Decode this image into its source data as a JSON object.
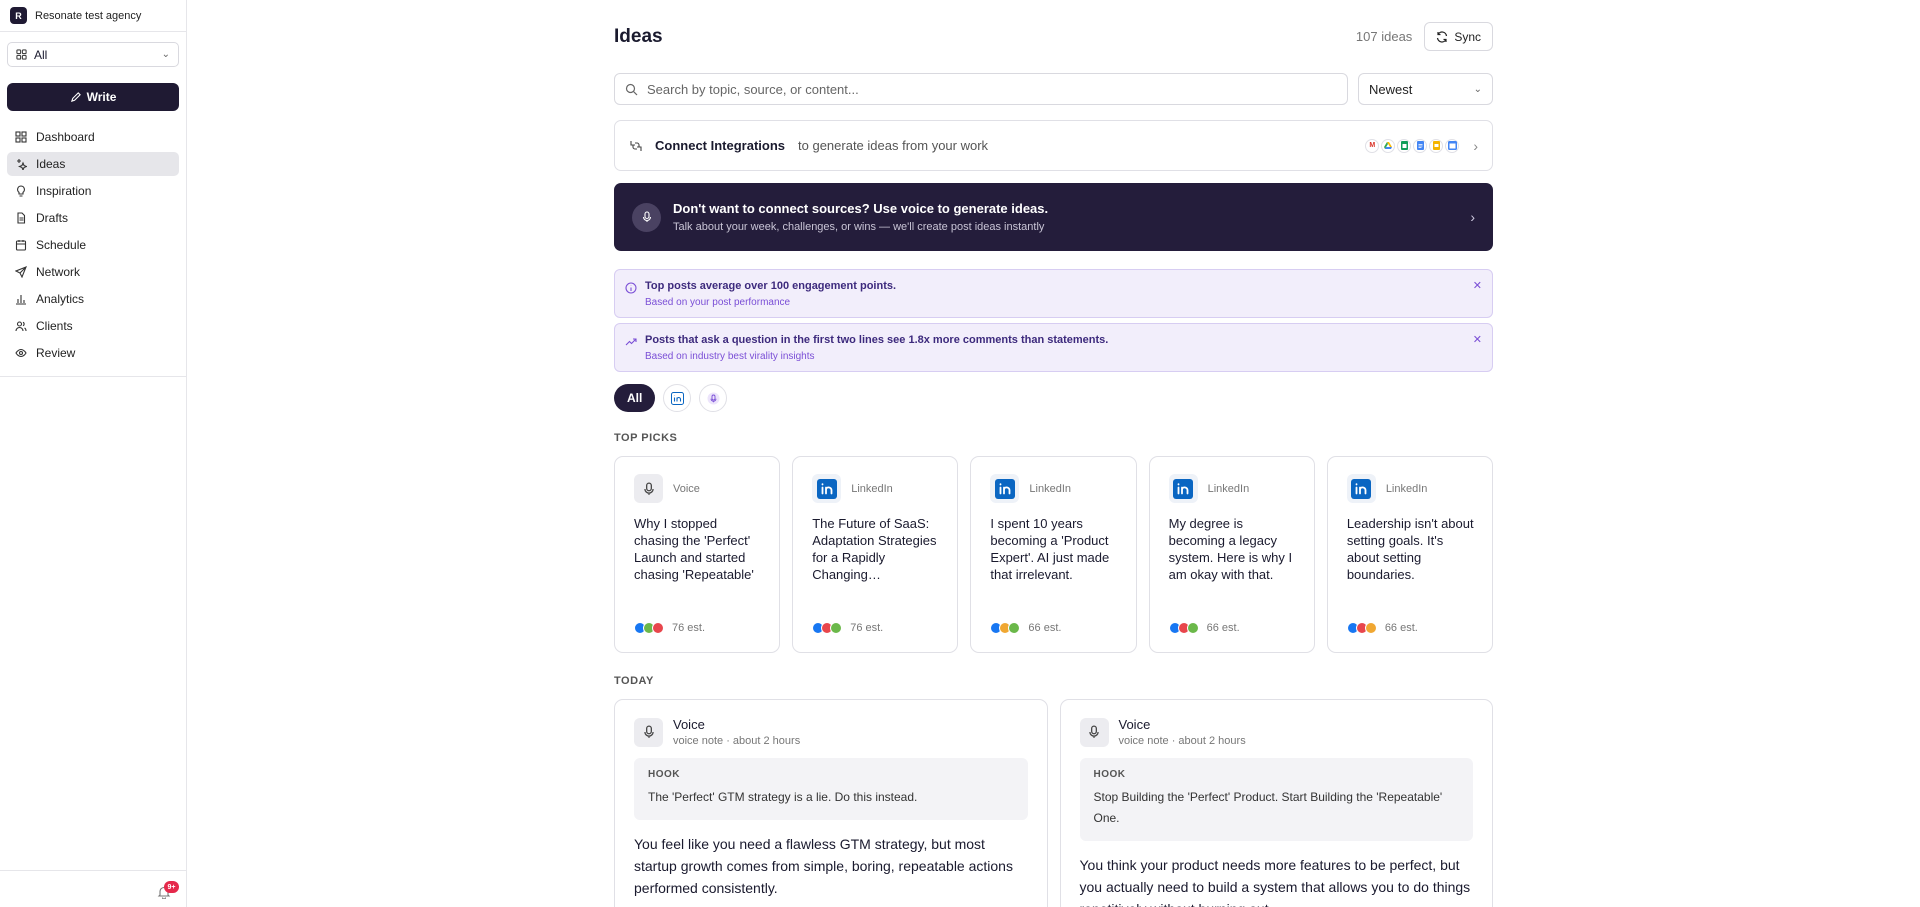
{
  "sidebar": {
    "org_initial": "R",
    "org_name": "Resonate test agency",
    "workspace": "All",
    "write_label": "Write",
    "nav": [
      {
        "label": "Dashboard",
        "icon": "dashboard-icon"
      },
      {
        "label": "Ideas",
        "icon": "sparkle-icon",
        "active": true
      },
      {
        "label": "Inspiration",
        "icon": "lightbulb-icon"
      },
      {
        "label": "Drafts",
        "icon": "document-icon"
      },
      {
        "label": "Schedule",
        "icon": "calendar-icon"
      },
      {
        "label": "Network",
        "icon": "send-icon"
      },
      {
        "label": "Analytics",
        "icon": "bar-chart-icon"
      },
      {
        "label": "Clients",
        "icon": "users-icon"
      },
      {
        "label": "Review",
        "icon": "eye-icon"
      }
    ],
    "notifications_badge": "9+"
  },
  "header": {
    "title": "Ideas",
    "count": "107 ideas",
    "sync_label": "Sync"
  },
  "search": {
    "placeholder": "Search by topic, source, or content...",
    "sort": "Newest"
  },
  "integrations": {
    "title": "Connect Integrations",
    "subtitle": "to generate ideas from your work",
    "icons": [
      "gmail-icon",
      "drive-icon",
      "sheets-icon",
      "docs-icon",
      "slides-icon",
      "calendar-icon"
    ]
  },
  "voice_banner": {
    "title": "Don't want to connect sources? Use voice to generate ideas.",
    "subtitle": "Talk about your week, challenges, or wins — we'll create post ideas instantly"
  },
  "insights": [
    {
      "title": "Top posts average over 100 engagement points.",
      "source": "Based on your post performance",
      "icon": "info-icon"
    },
    {
      "title": "Posts that ask a question in the first two lines see 1.8x more comments than statements.",
      "source": "Based on industry best virality insights",
      "icon": "trending-up-icon"
    }
  ],
  "filters": {
    "all_label": "All"
  },
  "top_picks": {
    "label": "TOP PICKS",
    "items": [
      {
        "source": "Voice",
        "kind": "voice",
        "title": "Why I stopped chasing the 'Perfect' Launch and started chasing 'Repeatable'",
        "est": "76 est."
      },
      {
        "source": "LinkedIn",
        "kind": "linkedin",
        "title": "The Future of SaaS: Adaptation Strategies for a Rapidly Changing…",
        "est": "76 est."
      },
      {
        "source": "LinkedIn",
        "kind": "linkedin",
        "title": "I spent 10 years becoming a 'Product Expert'. AI just made that irrelevant.",
        "est": "66 est."
      },
      {
        "source": "LinkedIn",
        "kind": "linkedin",
        "title": "My degree is becoming a legacy system. Here is why I am okay with that.",
        "est": "66 est."
      },
      {
        "source": "LinkedIn",
        "kind": "linkedin",
        "title": "Leadership isn't about setting goals. It's about setting boundaries.",
        "est": "66 est."
      }
    ]
  },
  "today": {
    "label": "TODAY",
    "items": [
      {
        "source": "Voice",
        "meta": "voice note · about 2 hours",
        "hook_label": "HOOK",
        "hook": "The 'Perfect' GTM strategy is a lie. Do this instead.",
        "body": "You feel like you need a flawless GTM strategy, but most startup growth comes from simple, boring, repeatable actions performed consistently."
      },
      {
        "source": "Voice",
        "meta": "voice note · about 2 hours",
        "hook_label": "HOOK",
        "hook": "Stop Building the 'Perfect' Product. Start Building the 'Repeatable' One.",
        "body": "You think your product needs more features to be perfect, but you actually need to build a system that allows you to do things repetitively without burning out."
      }
    ]
  },
  "colors": {
    "brand_dark": "#241d3b",
    "insight_bg": "#f2eefb",
    "linkedin": "#0a66c2",
    "badge_red": "#e5294b"
  }
}
